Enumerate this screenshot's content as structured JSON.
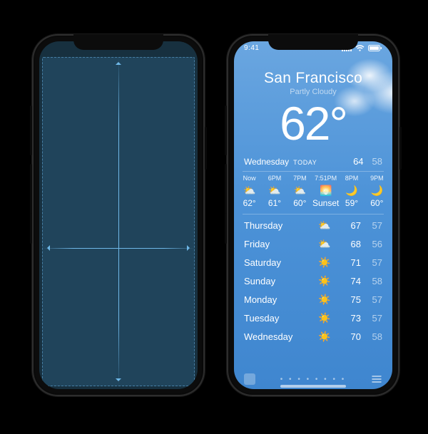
{
  "status": {
    "time": "9:41"
  },
  "hero": {
    "city": "San Francisco",
    "condition": "Partly Cloudy",
    "temp": "62°"
  },
  "today": {
    "day": "Wednesday",
    "today_label": "TODAY",
    "hi": "64",
    "lo": "58"
  },
  "hourly": [
    {
      "label": "Now",
      "icon": "partly-cloudy",
      "value": "62°"
    },
    {
      "label": "6PM",
      "icon": "partly-cloudy",
      "value": "61°"
    },
    {
      "label": "7PM",
      "icon": "partly-cloudy",
      "value": "60°"
    },
    {
      "label": "7:51PM",
      "icon": "sunset",
      "value": "Sunset"
    },
    {
      "label": "8PM",
      "icon": "clear-night",
      "value": "59°"
    },
    {
      "label": "9PM",
      "icon": "clear-night",
      "value": "60°"
    }
  ],
  "daily": [
    {
      "name": "Thursday",
      "icon": "partly-cloudy",
      "hi": "67",
      "lo": "57"
    },
    {
      "name": "Friday",
      "icon": "partly-cloudy",
      "hi": "68",
      "lo": "56"
    },
    {
      "name": "Saturday",
      "icon": "sunny",
      "hi": "71",
      "lo": "57"
    },
    {
      "name": "Sunday",
      "icon": "sunny",
      "hi": "74",
      "lo": "58"
    },
    {
      "name": "Monday",
      "icon": "sunny",
      "hi": "75",
      "lo": "57"
    },
    {
      "name": "Tuesday",
      "icon": "sunny",
      "hi": "73",
      "lo": "57"
    },
    {
      "name": "Wednesday",
      "icon": "sunny",
      "hi": "70",
      "lo": "58"
    }
  ],
  "page_dots": "• • • • • • • •"
}
